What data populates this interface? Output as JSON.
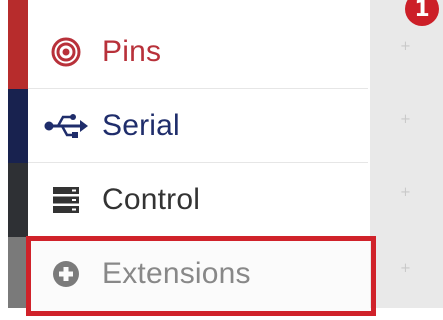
{
  "menu": {
    "items": [
      {
        "label": "Pins",
        "icon": "target-icon",
        "color": "#b8313a",
        "stripe": "#b72c2c"
      },
      {
        "label": "Serial",
        "icon": "usb-icon",
        "color": "#1f2d6b",
        "stripe": "#18224f"
      },
      {
        "label": "Control",
        "icon": "server-stack-icon",
        "color": "#333333",
        "stripe": "#2e3034"
      },
      {
        "label": "Extensions",
        "icon": "plus-circle-icon",
        "color": "#666666",
        "stripe": "#7a7a7a"
      }
    ]
  },
  "highlight": {
    "color": "#d0222a"
  },
  "callout": {
    "number": "1",
    "color": "#cc1f28"
  },
  "workspace": {
    "plus_glyph": "+"
  }
}
